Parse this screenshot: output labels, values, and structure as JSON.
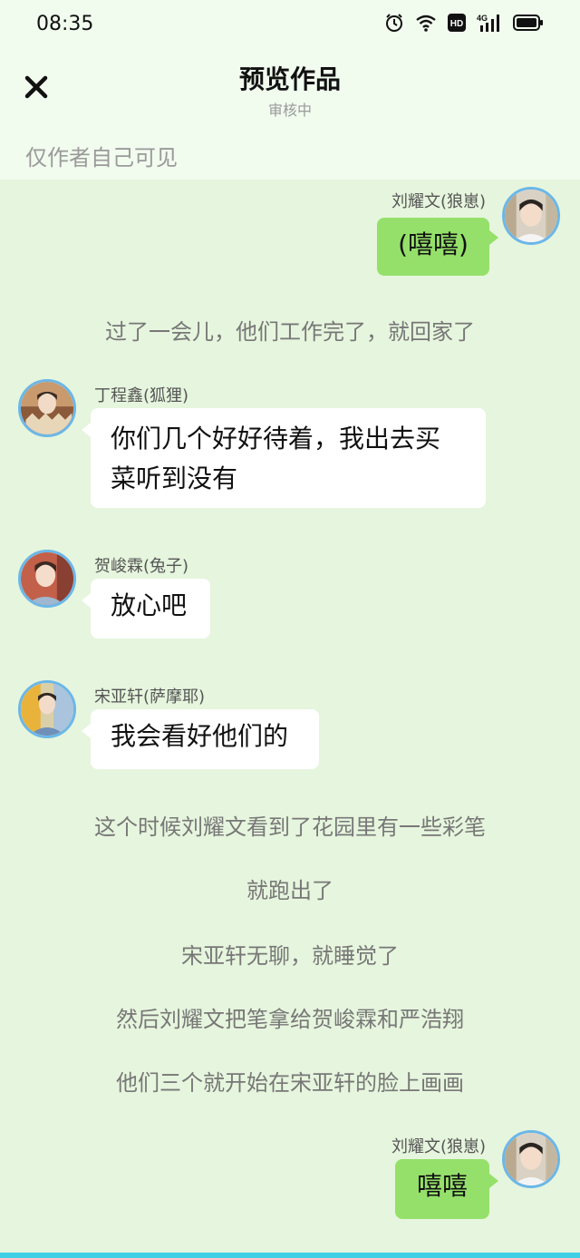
{
  "status_bar": {
    "time": "08:35",
    "icons": [
      "alarm-icon",
      "wifi-icon",
      "hd-icon",
      "signal-4g-icon",
      "battery-icon"
    ],
    "signal_label": "4G",
    "hd_label": "HD"
  },
  "header": {
    "title": "预览作品",
    "subtitle": "审核中",
    "close_icon": "close-icon"
  },
  "notice": "仅作者自己可见",
  "colors": {
    "chat_bg": "#e6f5dd",
    "header_bg": "#f1fbee",
    "right_bubble": "#95e06a",
    "left_bubble": "#ffffff",
    "avatar_ring": "#6bb7e8"
  },
  "messages": [
    {
      "type": "right",
      "name": "刘耀文(狼崽)",
      "text": "(嘻嘻)"
    },
    {
      "type": "narration",
      "text": "过了一会儿，他们工作完了，就回家了"
    },
    {
      "type": "left",
      "name": "丁程鑫(狐狸)",
      "line1": "你们几个好好待着，我出去买",
      "line2": "菜听到没有"
    },
    {
      "type": "left",
      "name": "贺峻霖(兔子)",
      "text": "放心吧"
    },
    {
      "type": "left",
      "name": "宋亚轩(萨摩耶)",
      "text": "我会看好他们的"
    },
    {
      "type": "narration",
      "text": "这个时候刘耀文看到了花园里有一些彩笔"
    },
    {
      "type": "narration",
      "text": "就跑出了"
    },
    {
      "type": "narration",
      "text": "宋亚轩无聊，就睡觉了"
    },
    {
      "type": "narration",
      "text": "然后刘耀文把笔拿给贺峻霖和严浩翔"
    },
    {
      "type": "narration",
      "text": "他们三个就开始在宋亚轩的脸上画画"
    },
    {
      "type": "right",
      "name": "刘耀文(狼崽)",
      "text": "嘻嘻"
    }
  ]
}
